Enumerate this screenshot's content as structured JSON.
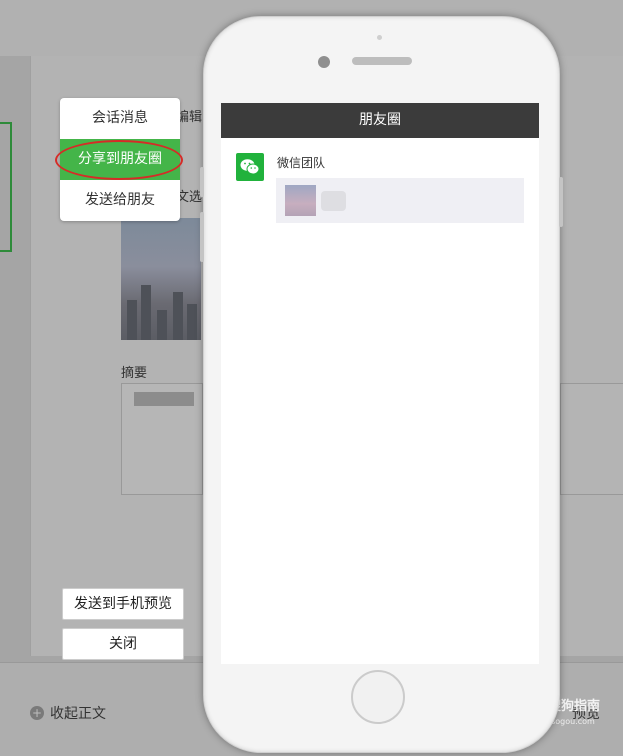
{
  "background": {
    "editor_label": "编辑",
    "editor_label2": "文选",
    "summary_label": "摘要"
  },
  "share_menu": {
    "items": [
      {
        "label": "会话消息",
        "active": false
      },
      {
        "label": "分享到朋友圈",
        "active": true
      },
      {
        "label": "发送给朋友",
        "active": false
      }
    ],
    "accent": "#44b549",
    "highlight_color": "#d62b27"
  },
  "buttons": {
    "send_preview": "发送到手机预览",
    "close": "关闭"
  },
  "footer": {
    "collapse_label": "收起正文",
    "right_label": "预览"
  },
  "watermark": {
    "brand": "搜狗指南",
    "url": "zhinan.sogou.com"
  },
  "phone": {
    "title": "朋友圈",
    "author": "微信团队",
    "avatar_icon": "wechat-icon"
  }
}
